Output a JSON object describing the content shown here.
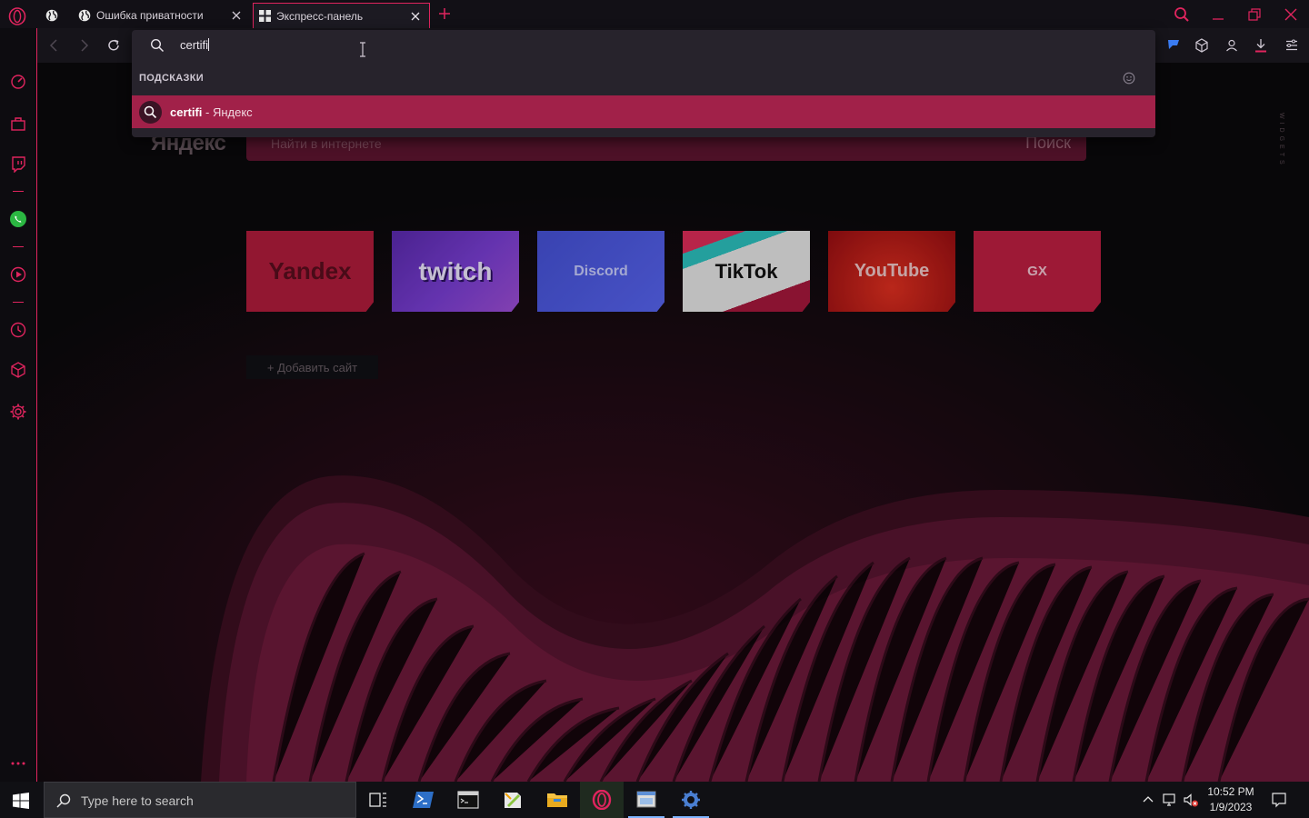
{
  "browser": {
    "tabs": [
      {
        "title": "",
        "icon": "globe-icon"
      },
      {
        "title": "Ошибка приватности",
        "icon": "globe-icon"
      },
      {
        "title": "Экспресс-панель",
        "icon": "grid-icon",
        "active": true
      }
    ]
  },
  "omnibox": {
    "query": "certifi",
    "suggestions_header": "ПОДСКАЗКИ",
    "suggestion": {
      "query": "certifi",
      "source": " - Яндекс"
    }
  },
  "page": {
    "yandex_logo": "Яндекс",
    "search_placeholder": "Найти в интернете",
    "search_button": "Поиск",
    "widgets_label": "WIDGETS",
    "speed_dials": [
      {
        "label": "Yandex",
        "color": "#c0203f"
      },
      {
        "label": "twitch",
        "color": "#7b3fd6"
      },
      {
        "label": "Discord",
        "color": "#5865f2"
      },
      {
        "label": "TikTok",
        "color": "#f1f1f1"
      },
      {
        "label": "YouTube",
        "color": "#d01818"
      },
      {
        "label": "GX",
        "color": "#c92547"
      }
    ],
    "add_site": "+ Добавить сайт"
  },
  "taskbar": {
    "search_placeholder": "Type here to search",
    "time": "10:52 PM",
    "date": "1/9/2023"
  },
  "colors": {
    "accent": "#e0245e",
    "suggestion_highlight": "#a12149"
  }
}
